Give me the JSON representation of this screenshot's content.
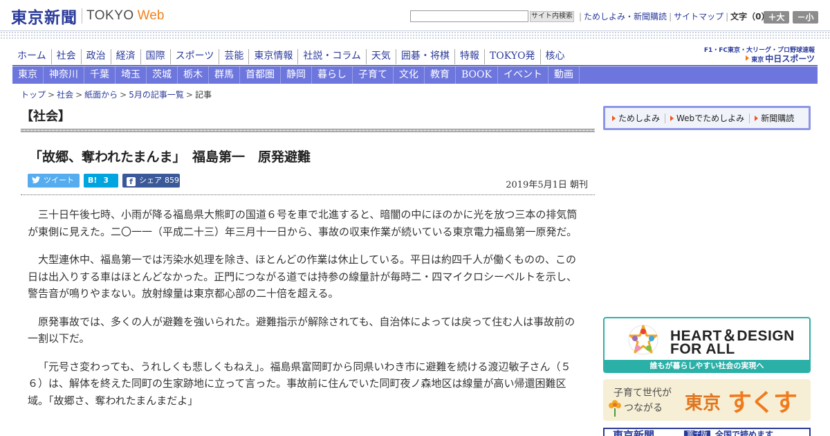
{
  "header": {
    "logo_jp": "東京新聞",
    "logo_en1": "TOKYO",
    "logo_en2": "Web",
    "search_placeholder": "",
    "search_button": "サイト内検索",
    "util_link1": "ためしよみ・新聞購読",
    "util_link2": "サイトマップ",
    "font_size_label": "文字（0）",
    "font_larger": "＋大",
    "font_smaller": "－小"
  },
  "nav_main": [
    "ホーム",
    "社会",
    "政治",
    "経済",
    "国際",
    "スポーツ",
    "芸能",
    "東京情報",
    "社説・コラム",
    "天気",
    "囲碁・将棋",
    "特報",
    "TOKYO発",
    "核心"
  ],
  "chunichi_sports": {
    "small": "F1・FC東京・大リーグ・プロ野球速報",
    "prefix": "東京",
    "brand": "中日スポーツ"
  },
  "nav_region": [
    "東京",
    "神奈川",
    "千葉",
    "埼玉",
    "茨城",
    "栃木",
    "群馬",
    "首都圏",
    "静岡",
    "暮らし",
    "子育て",
    "文化",
    "教育",
    "BOOK",
    "イベント",
    "動画"
  ],
  "breadcrumb": {
    "items": [
      "トップ",
      "社会",
      "紙面から",
      "5月の記事一覧"
    ],
    "current": "記事",
    "sep": ">"
  },
  "article": {
    "section": "【社会】",
    "headline": "「故郷、奪われたまんま」　福島第一　原発避難",
    "date": "2019年5月1日 朝刊",
    "paragraphs": [
      "三十日午後七時、小雨が降る福島県大熊町の国道６号を車で北進すると、暗闇の中にほのかに光を放つ三本の排気筒が東側に見えた。二〇一一（平成二十三）年三月十一日から、事故の収束作業が続いている東京電力福島第一原発だ。",
      "大型連休中、福島第一では汚染水処理を除き、ほとんどの作業は休止している。平日は約四千人が働くものの、この日は出入りする車はほとんどなかった。正門につながる道では持参の線量計が毎時二・四マイクロシーベルトを示し、警告音が鳴りやまない。放射線量は東京都心部の二十倍を超える。",
      "原発事故では、多くの人が避難を強いられた。避難指示が解除されても、自治体によっては戻って住む人は事故前の一割以下だ。",
      "「元号さ変わっても、うれしくも悲しくもねえ」。福島県富岡町から同県いわき市に避難を続ける渡辺敏子さん（５６）は、解体を終えた同町の生家跡地に立って言った。事故前に住んでいた同町夜ノ森地区は線量が高い帰還困難区域。「故郷さ、奪われたまんまだよ」"
    ]
  },
  "share": {
    "tweet_label": "ツイート",
    "hatena_icon": "B!",
    "hatena_count": "3",
    "fb_icon": "f",
    "fb_label": "シェア",
    "fb_count": "859"
  },
  "sidebar": {
    "sub_links": [
      "ためしよみ",
      "Webでためしよみ",
      "新聞購読"
    ],
    "heart_line1": "HEART＆DESIGN",
    "heart_line2": "FOR ALL",
    "heart_strip": "誰もが暮らしやすい社会の実現へ",
    "suku_sub1": "子育て世代が",
    "suku_sub2": "つながる",
    "suku_tokyo": "東京",
    "suku_main": "すくすく",
    "bottom_logo": "東京新聞",
    "bottom_tag": "電子版",
    "bottom_text": "全国で読めます"
  },
  "colors": {
    "brand_blue": "#2a3a9a",
    "nav_region_bg": "#6d76dd",
    "accent_orange": "#f0821e",
    "heart_teal": "#2bb0a7"
  }
}
